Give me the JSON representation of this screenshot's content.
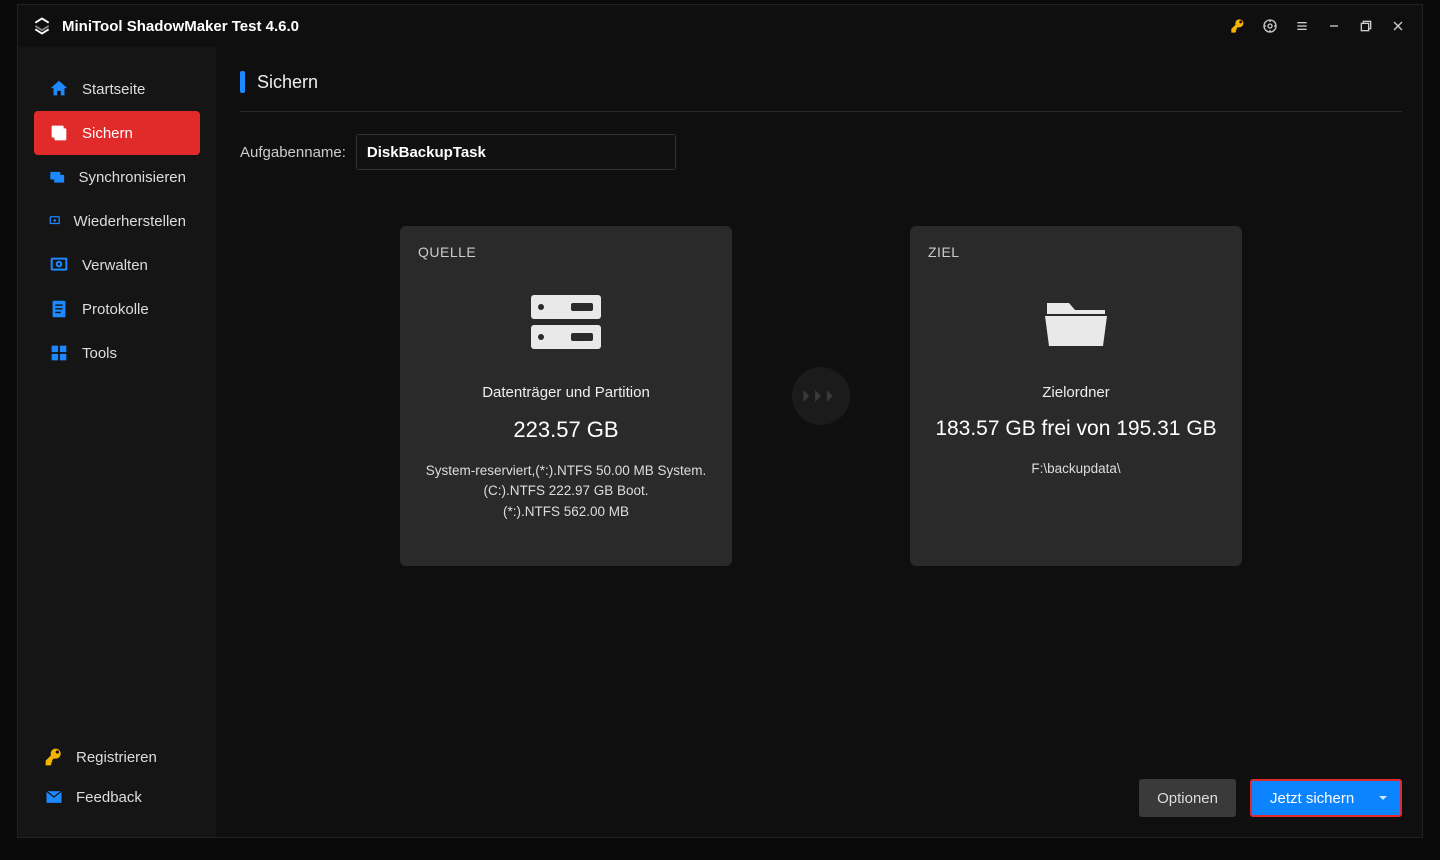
{
  "titlebar": {
    "title": "MiniTool ShadowMaker Test 4.6.0"
  },
  "sidebar": {
    "items": [
      {
        "label": "Startseite"
      },
      {
        "label": "Sichern"
      },
      {
        "label": "Synchronisieren"
      },
      {
        "label": "Wiederherstellen"
      },
      {
        "label": "Verwalten"
      },
      {
        "label": "Protokolle"
      },
      {
        "label": "Tools"
      }
    ],
    "register": "Registrieren",
    "feedback": "Feedback"
  },
  "page": {
    "title": "Sichern",
    "taskname_label": "Aufgabenname:",
    "taskname_value": "DiskBackupTask"
  },
  "source": {
    "header": "QUELLE",
    "subtitle": "Datenträger und Partition",
    "size": "223.57 GB",
    "details": "System-reserviert,(*:).NTFS 50.00 MB System.\n(C:).NTFS 222.97 GB Boot.\n(*:).NTFS 562.00 MB"
  },
  "dest": {
    "header": "ZIEL",
    "subtitle": "Zielordner",
    "size": "183.57 GB frei von 195.31 GB",
    "path": "F:\\backupdata\\"
  },
  "footer": {
    "options": "Optionen",
    "backup_now": "Jetzt sichern"
  }
}
